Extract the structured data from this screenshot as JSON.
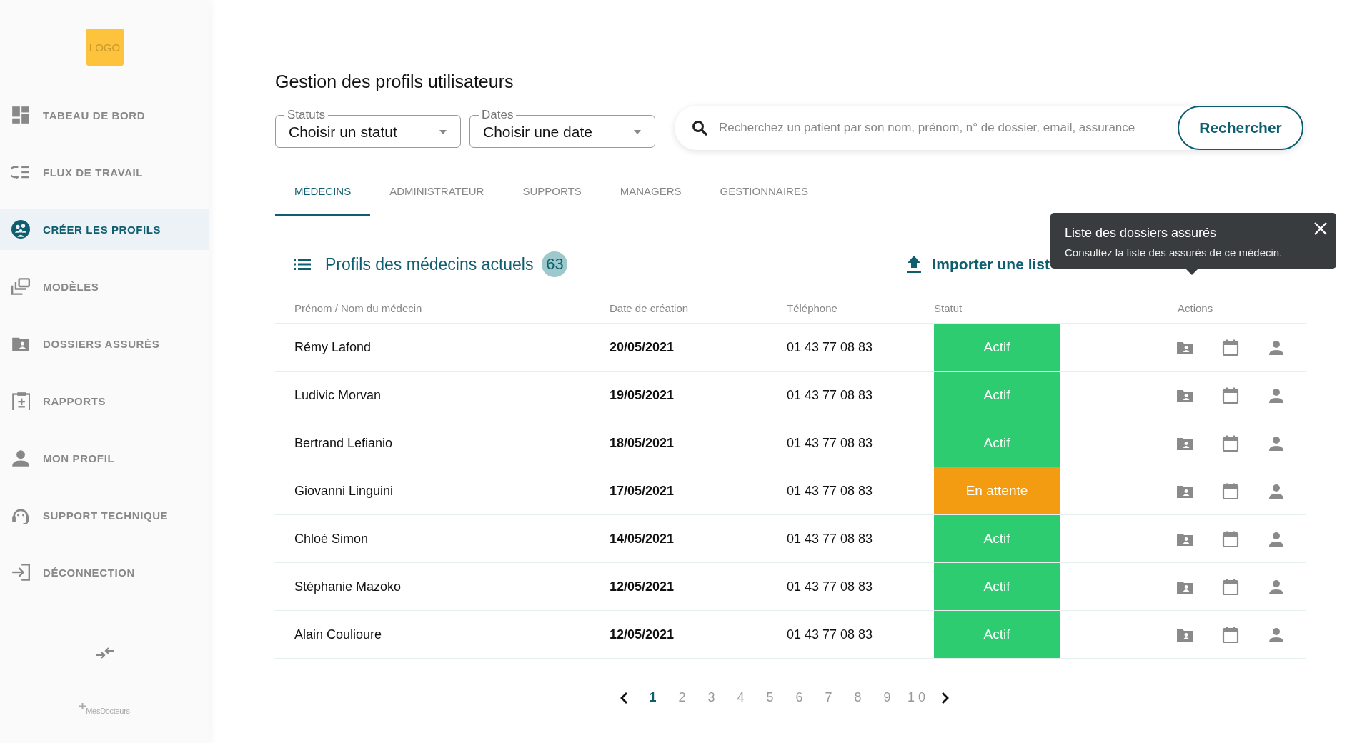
{
  "sidebar": {
    "logo": "LOGO",
    "items": [
      {
        "label": "TABEAU DE BORD",
        "selected": false
      },
      {
        "label": "FLUX DE TRAVAIL",
        "selected": false
      },
      {
        "label": "CRÉER LES PROFILS",
        "selected": true
      },
      {
        "label": "MODÈLES",
        "selected": false
      },
      {
        "label": "DOSSIERS ASSURÉS",
        "selected": false
      },
      {
        "label": "RAPPORTS",
        "selected": false
      },
      {
        "label": "MON PROFIL",
        "selected": false
      },
      {
        "label": "SUPPORT TECHNIQUE",
        "selected": false
      },
      {
        "label": "DÉCONNECTION",
        "selected": false
      }
    ],
    "brand": "MesDocteurs"
  },
  "page_title": "Gestion des profils utilisateurs",
  "filters": [
    {
      "label": "Statuts",
      "value": "Choisir un statut"
    },
    {
      "label": "Dates",
      "value": "Choisir une date"
    }
  ],
  "search": {
    "placeholder": "Recherchez un patient par son nom, prénom, n° de dossier, email, assurance",
    "button": "Rechercher"
  },
  "tabs": [
    {
      "label": "MÉDECINS",
      "selected": true
    },
    {
      "label": "ADMINISTRATEUR",
      "selected": false
    },
    {
      "label": "SUPPORTS",
      "selected": false
    },
    {
      "label": "MANAGERS",
      "selected": false
    },
    {
      "label": "GESTIONNAIRES",
      "selected": false
    }
  ],
  "section": {
    "title": "Profils des médecins actuels",
    "count": "63",
    "import": "Importer une list"
  },
  "table": {
    "columns": [
      "Prénom / Nom du médecin",
      "Date de création",
      "Téléphone",
      "Statut",
      "Actions"
    ],
    "rows": [
      {
        "name": "Rémy Lafond",
        "date": "20/05/2021",
        "phone": "01 43 77 08 83",
        "status": {
          "label": "Actif",
          "color": "#2ecc71"
        }
      },
      {
        "name": "Ludivic Morvan",
        "date": "19/05/2021",
        "phone": "01 43 77 08 83",
        "status": {
          "label": "Actif",
          "color": "#2ecc71"
        }
      },
      {
        "name": "Bertrand Lefianio",
        "date": "18/05/2021",
        "phone": "01 43 77 08 83",
        "status": {
          "label": "Actif",
          "color": "#2ecc71"
        }
      },
      {
        "name": "Giovanni Linguini",
        "date": "17/05/2021",
        "phone": "01 43 77 08 83",
        "status": {
          "label": "En attente",
          "color": "#f39c12"
        }
      },
      {
        "name": "Chloé Simon",
        "date": "14/05/2021",
        "phone": "01 43 77 08 83",
        "status": {
          "label": "Actif",
          "color": "#2ecc71"
        }
      },
      {
        "name": "Stéphanie Mazoko",
        "date": "12/05/2021",
        "phone": "01 43 77 08 83",
        "status": {
          "label": "Actif",
          "color": "#2ecc71"
        }
      },
      {
        "name": "Alain Coulioure",
        "date": "12/05/2021",
        "phone": "01 43 77 08 83",
        "status": {
          "label": "Actif",
          "color": "#2ecc71"
        }
      }
    ]
  },
  "tooltip": {
    "title": "Liste des dossiers assurés",
    "text": "Consultez la liste des assurés de ce médecin."
  },
  "pagination": {
    "pages": [
      {
        "label": "1",
        "selected": true
      },
      {
        "label": "2",
        "selected": false
      },
      {
        "label": "3",
        "selected": false
      },
      {
        "label": "4",
        "selected": false
      },
      {
        "label": "5",
        "selected": false
      },
      {
        "label": "6",
        "selected": false
      },
      {
        "label": "7",
        "selected": false
      },
      {
        "label": "8",
        "selected": false
      },
      {
        "label": "9",
        "selected": false
      },
      {
        "label": "1 0",
        "selected": false
      }
    ]
  }
}
